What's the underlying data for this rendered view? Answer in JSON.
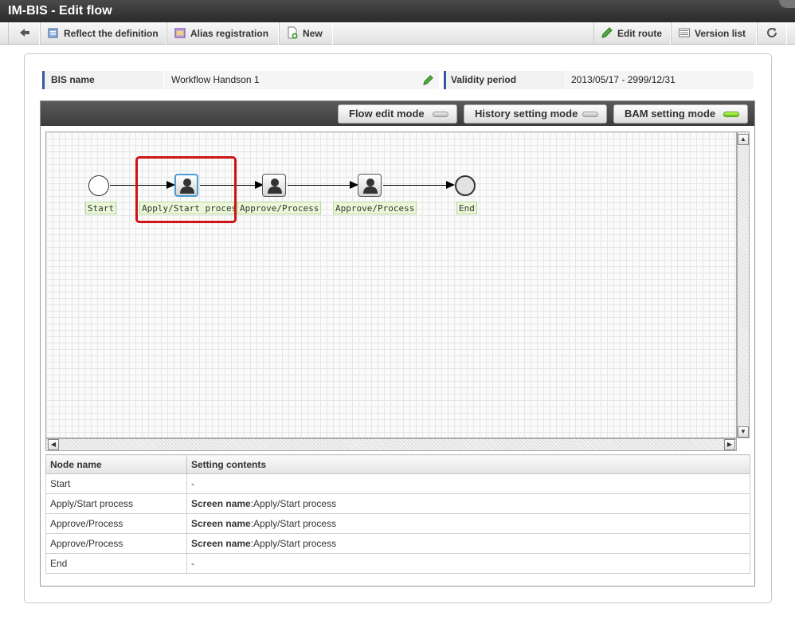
{
  "window": {
    "title": "IM-BIS - Edit flow"
  },
  "toolbar": {
    "back_icon": "arrow-left-icon",
    "reflect_label": "Reflect the definition",
    "alias_label": "Alias registration",
    "new_label": "New",
    "edit_route_label": "Edit route",
    "version_list_label": "Version list",
    "refresh_icon": "refresh-icon"
  },
  "info": {
    "bis_name_label": "BIS name",
    "bis_name_value": "Workflow Handson 1",
    "validity_label": "Validity period",
    "validity_value": "2013/05/17 - 2999/12/31"
  },
  "modes": {
    "flow_edit": {
      "label": "Flow edit mode",
      "on": false
    },
    "history": {
      "label": "History setting mode",
      "on": false
    },
    "bam": {
      "label": "BAM setting mode",
      "on": true
    }
  },
  "flow": {
    "nodes": [
      {
        "type": "start",
        "label": "Start"
      },
      {
        "type": "task",
        "label": "Apply/Start process",
        "selected": true
      },
      {
        "type": "task",
        "label": "Approve/Process"
      },
      {
        "type": "task",
        "label": "Approve/Process"
      },
      {
        "type": "end",
        "label": "End"
      }
    ]
  },
  "table": {
    "headers": {
      "node": "Node name",
      "settings": "Setting contents"
    },
    "rows": [
      {
        "node": "Start",
        "key": "",
        "value": "-"
      },
      {
        "node": "Apply/Start process",
        "key": "Screen name",
        "value": ":Apply/Start process"
      },
      {
        "node": "Approve/Process",
        "key": "Screen name",
        "value": ":Apply/Start process"
      },
      {
        "node": "Approve/Process",
        "key": "Screen name",
        "value": ":Apply/Start process"
      },
      {
        "node": "End",
        "key": "",
        "value": "-"
      }
    ]
  },
  "colors": {
    "accent": "#2f5a9c",
    "highlight": "#cc1414",
    "bam_on": "#5fbf14"
  }
}
